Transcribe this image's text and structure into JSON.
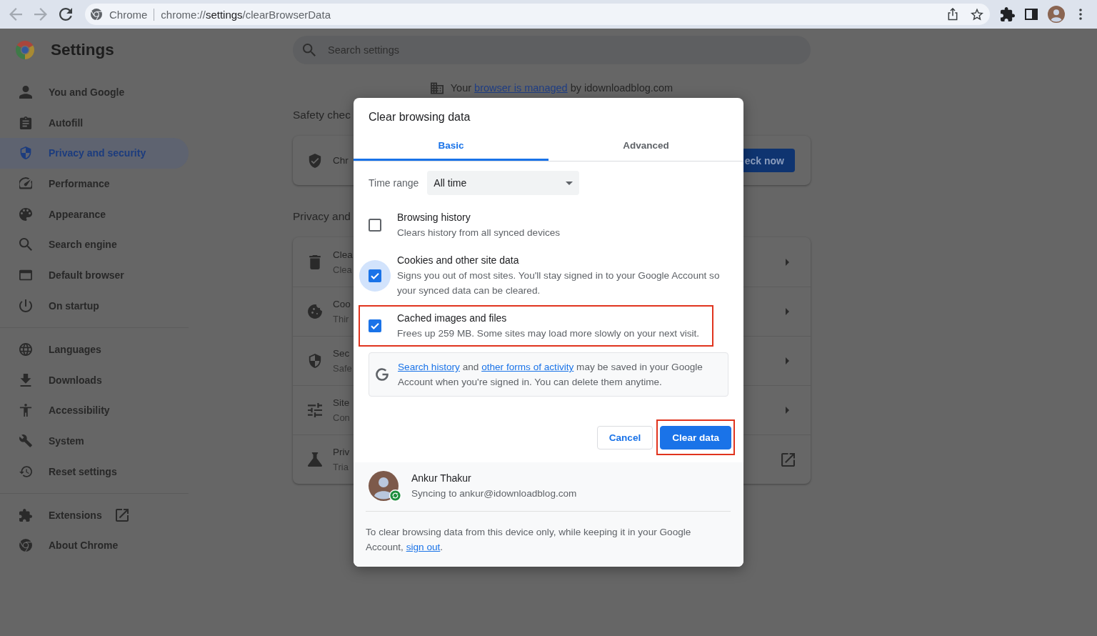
{
  "nav_buttons": [
    {
      "kind": "back",
      "disabled": true
    },
    {
      "kind": "forward",
      "disabled": true
    },
    {
      "kind": "reload",
      "disabled": false
    }
  ],
  "address_bar": {
    "site_label": "Chrome",
    "url": [
      {
        "text": "chrome://",
        "emphasized": false
      },
      {
        "text": "settings",
        "emphasized": true
      },
      {
        "text": "/clearBrowserData",
        "emphasized": false
      }
    ]
  },
  "sidebar": {
    "title": "Settings",
    "groups": [
      {
        "items": [
          {
            "label": "You and Google",
            "selected": false,
            "kind": "page"
          },
          {
            "label": "Autofill",
            "selected": false,
            "kind": "page"
          },
          {
            "label": "Privacy and security",
            "selected": true,
            "kind": "page"
          },
          {
            "label": "Performance",
            "selected": false,
            "kind": "page"
          },
          {
            "label": "Appearance",
            "selected": false,
            "kind": "page"
          },
          {
            "label": "Search engine",
            "selected": false,
            "kind": "page"
          },
          {
            "label": "Default browser",
            "selected": false,
            "kind": "page"
          },
          {
            "label": "On startup",
            "selected": false,
            "kind": "page"
          }
        ]
      },
      {
        "items": [
          {
            "label": "Languages",
            "selected": false,
            "kind": "page"
          },
          {
            "label": "Downloads",
            "selected": false,
            "kind": "page"
          },
          {
            "label": "Accessibility",
            "selected": false,
            "kind": "page"
          },
          {
            "label": "System",
            "selected": false,
            "kind": "page"
          },
          {
            "label": "Reset settings",
            "selected": false,
            "kind": "page"
          }
        ]
      },
      {
        "items": [
          {
            "label": "Extensions",
            "selected": false,
            "kind": "external"
          },
          {
            "label": "About Chrome",
            "selected": false,
            "kind": "page"
          }
        ]
      }
    ]
  },
  "search": {
    "placeholder": "Search settings"
  },
  "managed_notice": {
    "parts": [
      {
        "kind": "text",
        "text": "Your "
      },
      {
        "kind": "link",
        "text": "browser is managed"
      },
      {
        "kind": "text",
        "text": " by idownloadblog.com"
      }
    ]
  },
  "sections": [
    {
      "title": "Safety chec",
      "rows": [
        {
          "kind": "button",
          "title": "Chr",
          "action": "eck now"
        }
      ]
    },
    {
      "title": "Privacy and",
      "rows": [
        {
          "kind": "arrow",
          "title": "Clea",
          "subtitle": "Clea"
        },
        {
          "kind": "arrow",
          "title": "Coo",
          "subtitle": "Thir"
        },
        {
          "kind": "arrow",
          "title": "Sec",
          "subtitle": "Safe"
        },
        {
          "kind": "arrow",
          "title": "Site",
          "subtitle": "Con"
        },
        {
          "kind": "external",
          "title": "Priv",
          "subtitle": "Tria"
        }
      ]
    }
  ],
  "dialog": {
    "title": "Clear browsing data",
    "tabs": [
      {
        "label": "Basic",
        "selected": true
      },
      {
        "label": "Advanced",
        "selected": false
      }
    ],
    "time_range": {
      "label": "Time range",
      "value": "All time"
    },
    "options": [
      {
        "title": "Browsing history",
        "description": "Clears history from all synced devices",
        "checked": false,
        "focused": false,
        "highlighted": false
      },
      {
        "title": "Cookies and other site data",
        "description": "Signs you out of most sites. You'll stay signed in to your Google Account so your synced data can be cleared.",
        "checked": true,
        "focused": true,
        "highlighted": false
      },
      {
        "title": "Cached images and files",
        "description": "Frees up 259 MB. Some sites may load more slowly on your next visit.",
        "checked": true,
        "focused": false,
        "highlighted": true
      }
    ],
    "info": {
      "parts": [
        {
          "kind": "link",
          "text": "Search history"
        },
        {
          "kind": "text",
          "text": " and "
        },
        {
          "kind": "link",
          "text": "other forms of activity"
        },
        {
          "kind": "text",
          "text": " may be saved in your Google Account when you're signed in. You can delete them anytime."
        }
      ]
    },
    "buttons": [
      {
        "kind": "secondary",
        "label": "Cancel",
        "highlighted": false
      },
      {
        "kind": "primary",
        "label": "Clear data",
        "highlighted": true
      }
    ],
    "account": {
      "name": "Ankur Thakur",
      "status": "Syncing to ankur@idownloadblog.com",
      "syncing": true
    },
    "footer": {
      "parts": [
        {
          "kind": "text",
          "text": "To clear browsing data from this device only, while keeping it in your Google Account, "
        },
        {
          "kind": "link",
          "text": "sign out"
        },
        {
          "kind": "text",
          "text": "."
        }
      ]
    }
  }
}
